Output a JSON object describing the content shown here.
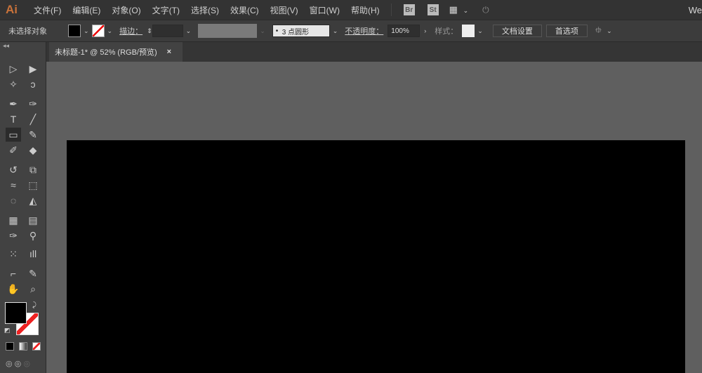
{
  "app": {
    "logo": "Ai",
    "workspace": "We"
  },
  "menu": [
    "文件(F)",
    "编辑(E)",
    "对象(O)",
    "文字(T)",
    "选择(S)",
    "效果(C)",
    "视图(V)",
    "窗口(W)",
    "帮助(H)"
  ],
  "menu_icons": {
    "bridge": "Br",
    "stock": "St"
  },
  "control": {
    "selection": "未选择对象",
    "stroke_label": "描边：",
    "brush": "3 点圆形",
    "opacity_label": "不透明度：",
    "opacity": "100%",
    "style_label": "样式：",
    "doc_setup": "文档设置",
    "prefs": "首选项"
  },
  "tab": {
    "title": "未标题-1* @ 52% (RGB/预览)",
    "close": "×"
  },
  "colors": {
    "fill": "#000000",
    "stroke": "none",
    "accent": "#c8723a"
  },
  "tools": [
    [
      "▷",
      "▶"
    ],
    [
      "✧",
      "ↄ"
    ],
    [
      "✒",
      "✑"
    ],
    [
      "T",
      "╱"
    ],
    [
      "▭",
      "✎"
    ],
    [
      "✐",
      "◆"
    ],
    [
      "↺",
      "⧉"
    ],
    [
      "≈",
      "⬚"
    ],
    [
      "◌",
      "◭"
    ],
    [
      "▦",
      "▤"
    ],
    [
      "✑",
      "⚲"
    ],
    [
      "⁙",
      "ıll"
    ],
    [
      "⌐",
      "✎"
    ],
    [
      "✋",
      "⌕"
    ]
  ]
}
